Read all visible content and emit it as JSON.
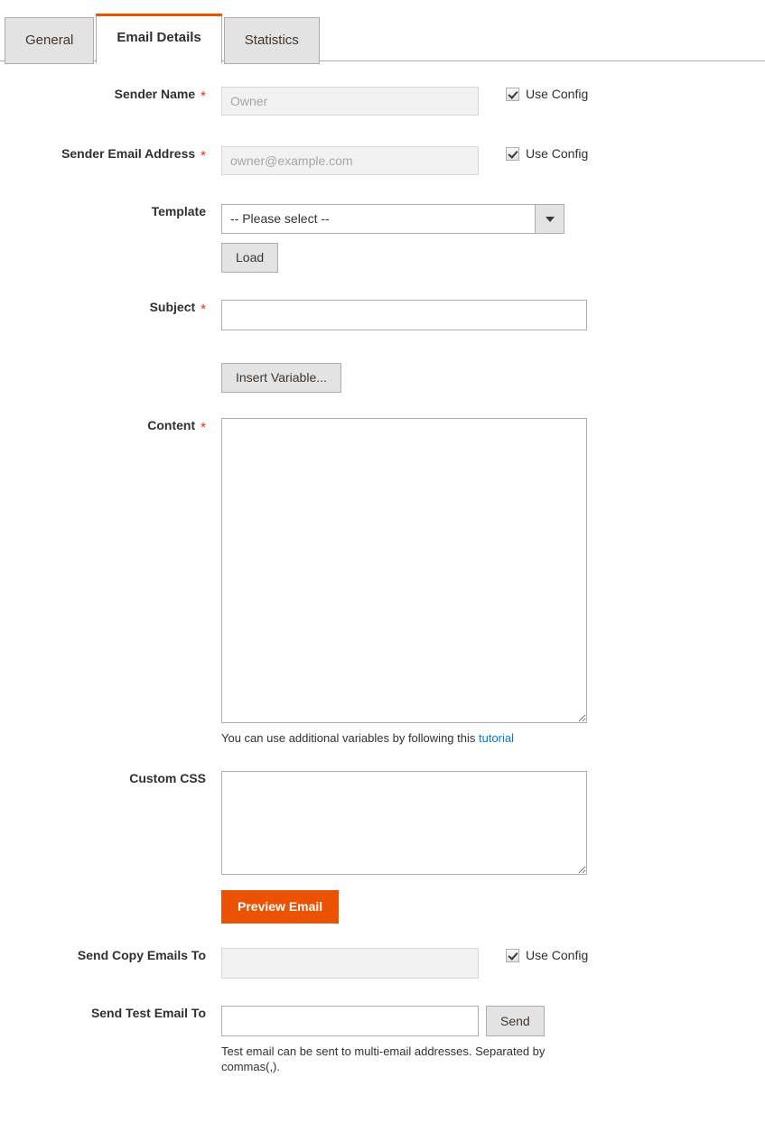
{
  "tabs": [
    {
      "label": "General",
      "active": false
    },
    {
      "label": "Email Details",
      "active": true
    },
    {
      "label": "Statistics",
      "active": false
    }
  ],
  "colors": {
    "accent": "#eb5202",
    "link": "#007bdb",
    "required": "#e02b27",
    "border": "#adadad",
    "button_bg": "#e3e3e3",
    "disabled_bg": "#f2f2f2"
  },
  "form": {
    "sender_name": {
      "label": "Sender Name",
      "required": "*",
      "value": "",
      "placeholder": "Owner",
      "use_config_label": "Use Config",
      "use_config_checked": true
    },
    "sender_email": {
      "label": "Sender Email Address",
      "required": "*",
      "value": "",
      "placeholder": "owner@example.com",
      "use_config_label": "Use Config",
      "use_config_checked": true
    },
    "template": {
      "label": "Template",
      "selected": "-- Please select --",
      "options": [
        "-- Please select --"
      ],
      "load_label": "Load"
    },
    "subject": {
      "label": "Subject",
      "required": "*",
      "value": "",
      "placeholder": "",
      "insert_variable_label": "Insert Variable..."
    },
    "content": {
      "label": "Content",
      "required": "*",
      "value": "",
      "placeholder": "",
      "note_prefix": "You can use additional variables by following this ",
      "note_link": "tutorial"
    },
    "custom_css": {
      "label": "Custom CSS",
      "value": "",
      "placeholder": "",
      "preview_label": "Preview Email"
    },
    "send_copy": {
      "label": "Send Copy Emails To",
      "value": "",
      "placeholder": "",
      "use_config_label": "Use Config",
      "use_config_checked": true
    },
    "send_test": {
      "label": "Send Test Email To",
      "value": "",
      "placeholder": "",
      "send_label": "Send",
      "note": "Test email can be sent to multi-email addresses. Separated by commas(,)."
    }
  }
}
